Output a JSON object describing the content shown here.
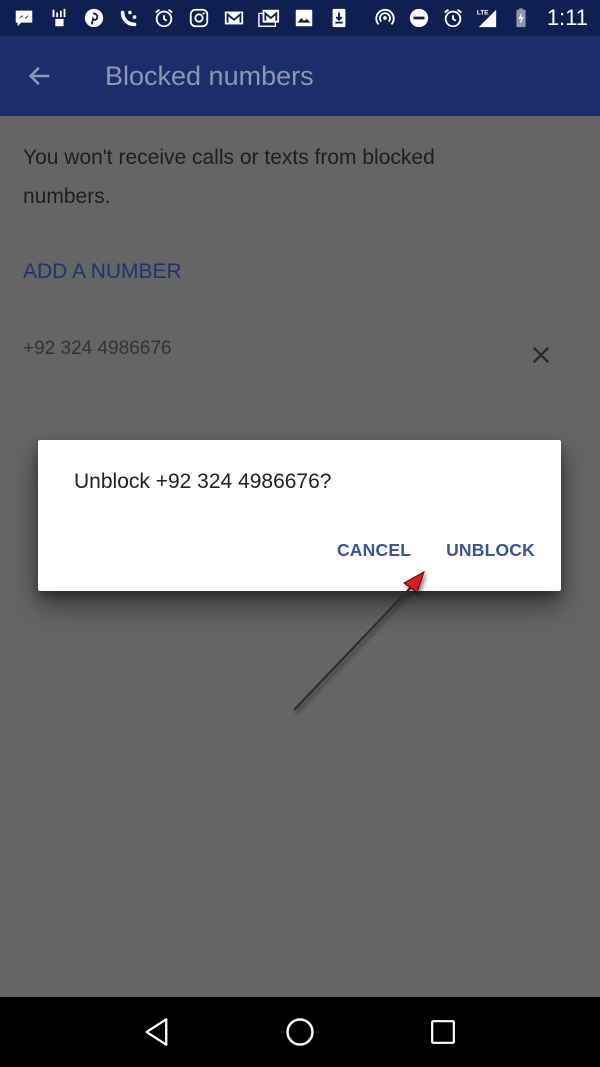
{
  "status_bar": {
    "left_icons": [
      "messenger-icon",
      "signal-bars-app-icon",
      "pinterest-icon",
      "viber-icon",
      "alarm-icon",
      "instagram-icon",
      "gmail-icon",
      "gmail-stack-icon",
      "image-icon",
      "download-icon"
    ],
    "right_icons": [
      "hotspot-icon",
      "do-not-disturb-icon",
      "alarm-icon",
      "lte-signal-icon",
      "battery-charging-icon"
    ],
    "network_label": "LTE",
    "time": "1:11"
  },
  "app_bar": {
    "back_icon": "arrow-back-icon",
    "title": "Blocked numbers"
  },
  "content": {
    "description": "You won't receive calls or texts from blocked numbers.",
    "add_number_label": "ADD A NUMBER",
    "blocked_numbers": [
      {
        "number": "+92 324 4986676",
        "remove_icon": "close-icon"
      }
    ]
  },
  "dialog": {
    "message": "Unblock +92 324 4986676?",
    "cancel_label": "CANCEL",
    "confirm_label": "UNBLOCK"
  },
  "annotation": {
    "type": "arrow",
    "points_to": "UNBLOCK",
    "head_color": "#e01b1b"
  },
  "nav_bar": {
    "icons": [
      "back-triangle-icon",
      "home-circle-icon",
      "recents-square-icon"
    ]
  },
  "colors": {
    "status_bar_bg": "#0f1f52",
    "app_bar_bg": "#1b2d6b",
    "scrim_bg": "#656565",
    "accent": "#3a52a0",
    "dialog_bg": "#ffffff"
  }
}
